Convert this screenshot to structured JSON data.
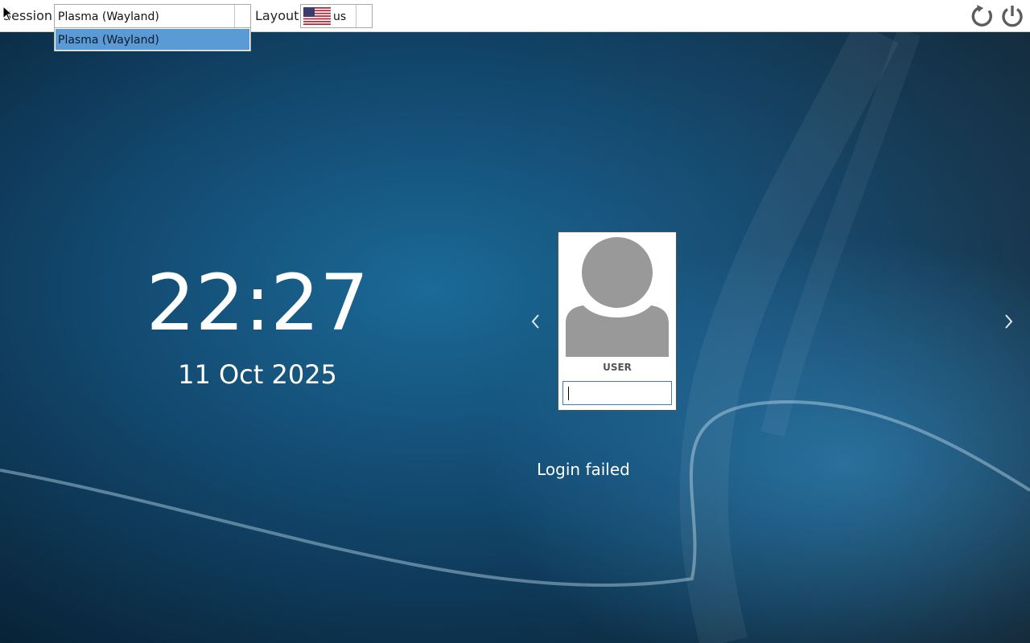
{
  "topbar": {
    "session_label": "Session",
    "session_value": "Plasma (Wayland)",
    "session_options": [
      "Plasma (Wayland)"
    ],
    "layout_label": "Layout",
    "layout_value": "us",
    "layout_flag_icon": "us-flag-icon",
    "reboot_icon": "reboot-icon",
    "power_icon": "power-icon"
  },
  "clock": {
    "time": "22:27",
    "date": "11 Oct 2025"
  },
  "user": {
    "name": "USER",
    "password_value": "",
    "avatar_icon": "user-avatar-icon"
  },
  "nav": {
    "prev_icon": "chevron-left-icon",
    "next_icon": "chevron-right-icon"
  },
  "status": {
    "message": "Login failed"
  },
  "colors": {
    "background": "#0c2f48",
    "accent": "#5b9bd5",
    "input_border": "#3b7fb8"
  }
}
